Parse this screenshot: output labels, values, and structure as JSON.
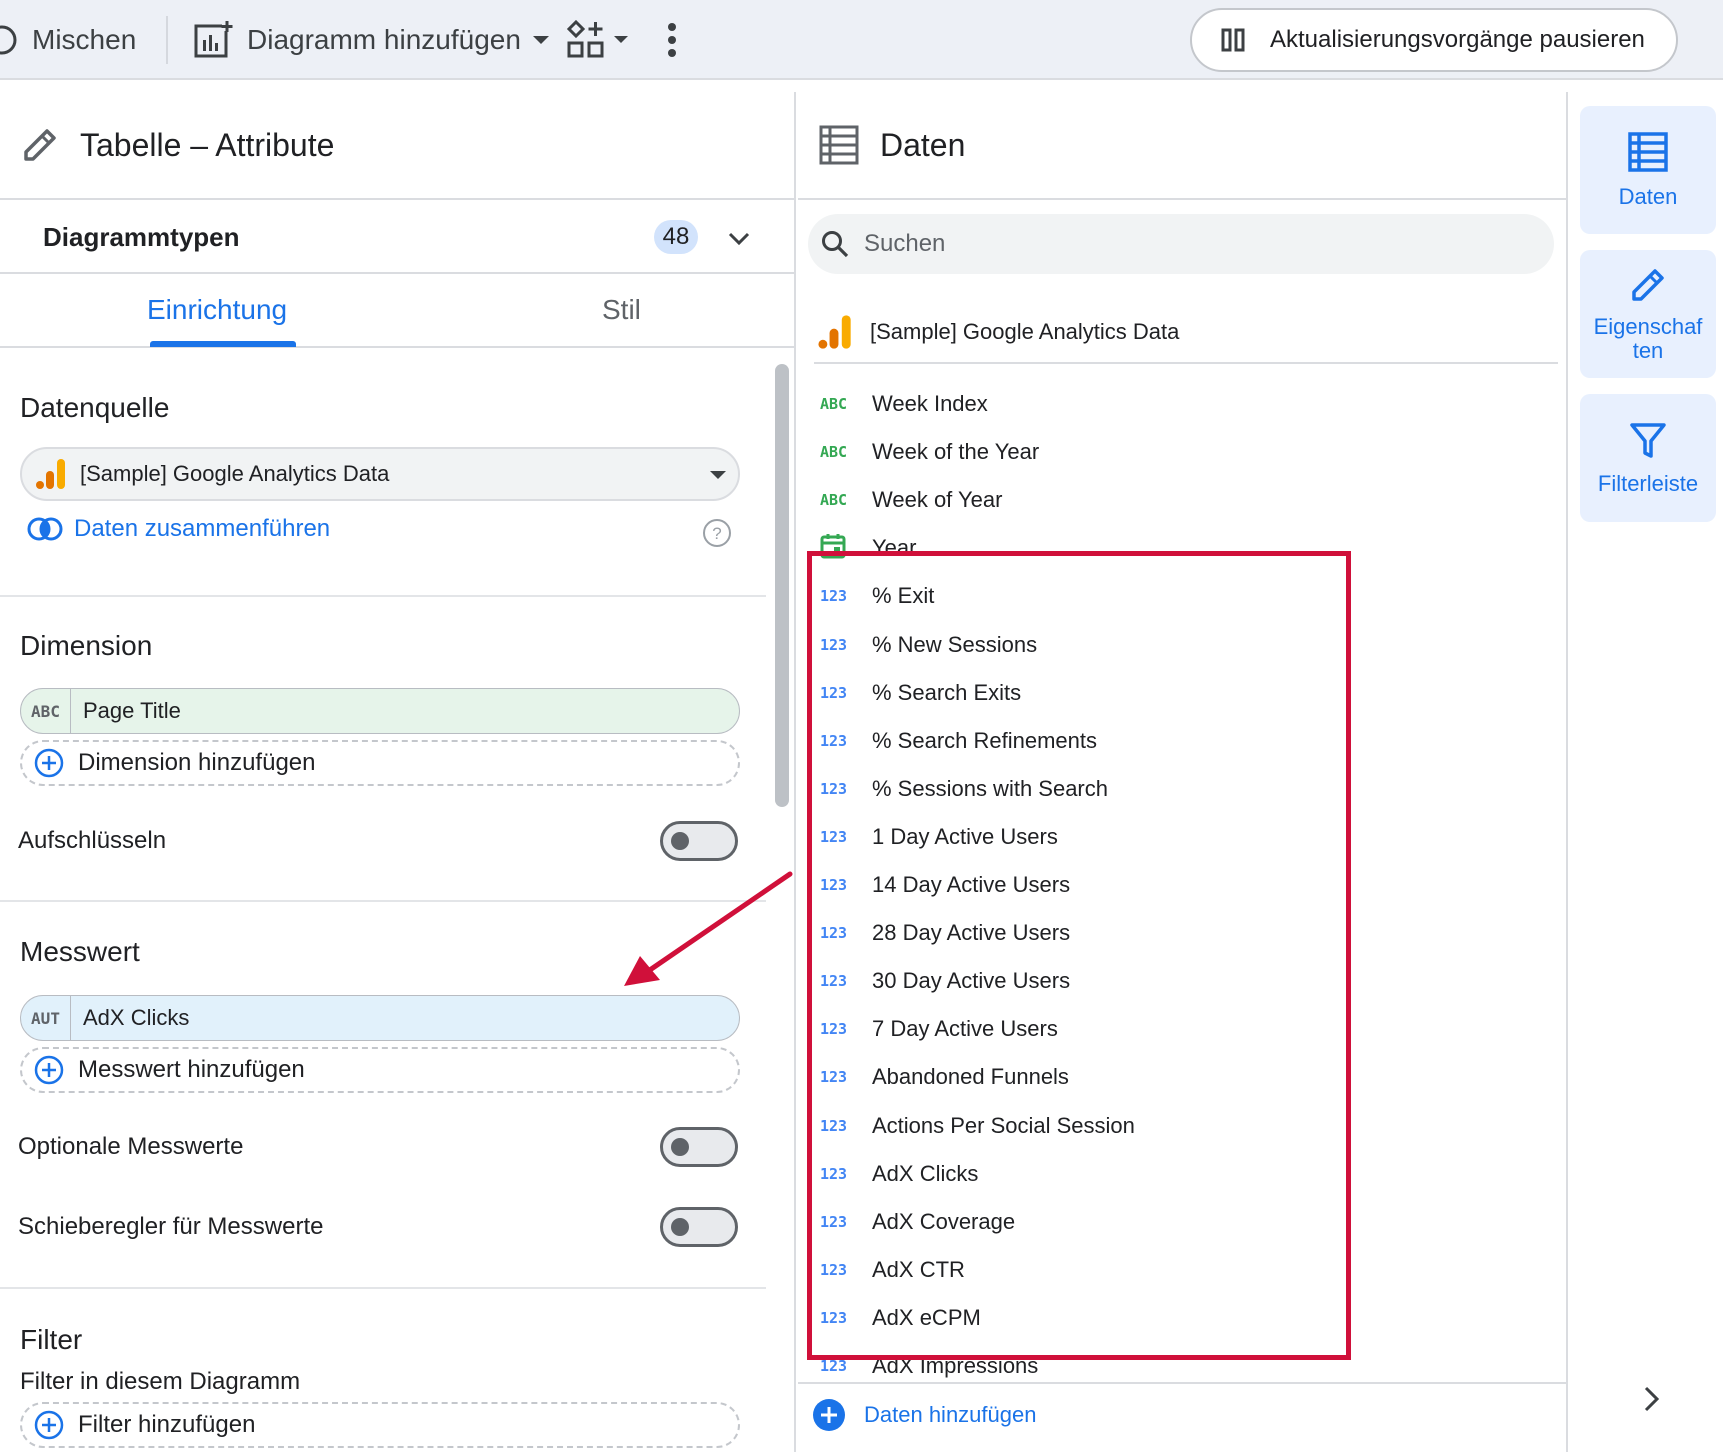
{
  "toolbar": {
    "mix_label": "Mischen",
    "add_chart_label": "Diagramm hinzufügen",
    "pause_label": "Aktualisierungsvorgänge pausieren"
  },
  "properties": {
    "title": "Tabelle – Attribute",
    "chart_types_label": "Diagrammtypen",
    "chart_types_count": "48",
    "tabs": [
      {
        "label": "Einrichtung",
        "active": true
      },
      {
        "label": "Stil",
        "active": false
      }
    ],
    "datasource": {
      "heading": "Datenquelle",
      "value": "[Sample] Google Analytics Data",
      "blend_label": "Daten zusammenführen"
    },
    "dimension": {
      "heading": "Dimension",
      "chip_tag": "ABC",
      "chip_value": "Page Title",
      "add_label": "Dimension hinzufügen",
      "drilldown_label": "Aufschlüsseln"
    },
    "metric": {
      "heading": "Messwert",
      "chip_tag": "AUT",
      "chip_value": "AdX Clicks",
      "add_label": "Messwert hinzufügen",
      "optional_label": "Optionale Messwerte",
      "slider_label": "Schieberegler für Messwerte"
    },
    "filter": {
      "heading": "Filter",
      "sublabel": "Filter in diesem Diagramm",
      "add_label": "Filter hinzufügen"
    }
  },
  "data_panel": {
    "title": "Daten",
    "search_placeholder": "Suchen",
    "source_name": "[Sample] Google Analytics Data",
    "fields": [
      {
        "type": "ABC",
        "name": "Week Index"
      },
      {
        "type": "ABC",
        "name": "Week of the Year"
      },
      {
        "type": "ABC",
        "name": "Week of Year"
      },
      {
        "type": "date",
        "name": "Year"
      },
      {
        "type": "123",
        "name": "% Exit"
      },
      {
        "type": "123",
        "name": "% New Sessions"
      },
      {
        "type": "123",
        "name": "% Search Exits"
      },
      {
        "type": "123",
        "name": "% Search Refinements"
      },
      {
        "type": "123",
        "name": "% Sessions with Search"
      },
      {
        "type": "123",
        "name": "1 Day Active Users"
      },
      {
        "type": "123",
        "name": "14 Day Active Users"
      },
      {
        "type": "123",
        "name": "28 Day Active Users"
      },
      {
        "type": "123",
        "name": "30 Day Active Users"
      },
      {
        "type": "123",
        "name": "7 Day Active Users"
      },
      {
        "type": "123",
        "name": "Abandoned Funnels"
      },
      {
        "type": "123",
        "name": "Actions Per Social Session"
      },
      {
        "type": "123",
        "name": "AdX Clicks"
      },
      {
        "type": "123",
        "name": "AdX Coverage"
      },
      {
        "type": "123",
        "name": "AdX CTR"
      },
      {
        "type": "123",
        "name": "AdX eCPM"
      },
      {
        "type": "123",
        "name": "AdX Impressions"
      }
    ],
    "add_data_label": "Daten hinzufügen"
  },
  "rail": {
    "items": [
      {
        "label": "Daten",
        "icon": "table-icon"
      },
      {
        "label": "Eigenschaf ten",
        "icon": "pencil-icon"
      },
      {
        "label": "Filterleiste",
        "icon": "filter-icon"
      }
    ]
  },
  "colors": {
    "accent": "#1a73e8",
    "highlight_border": "#d0103a",
    "dimension_chip": "#e6f4ea",
    "metric_chip": "#e1f1fb"
  }
}
